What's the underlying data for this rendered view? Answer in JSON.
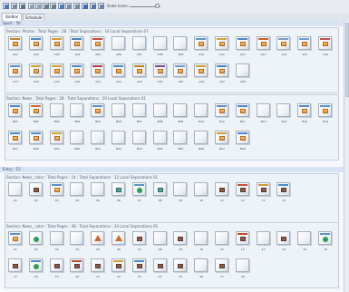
{
  "toolbar": {
    "scale_label": "Scale Icons:",
    "slider_value": 0.9,
    "icons": [
      "grid-view-icon",
      "list-view-icon",
      "page-view-icon",
      "zoom-out-icon",
      "zoom-in-icon",
      "undo-icon",
      "redo-icon",
      "refresh-icon",
      "print-icon",
      "settings-icon",
      "bar-chart-icon",
      "table-icon",
      "layers-icon"
    ]
  },
  "tabs": [
    {
      "label": "BinBox",
      "active": true
    },
    {
      "label": "Schedule",
      "active": false
    }
  ],
  "groups": [
    {
      "header": "Sport : 56",
      "sections": [
        {
          "title": "Section: Photos : Total Pages : 28 : Total Separations : 16 Local Separations 07",
          "pages": [
            {
              "label": "A01",
              "color": "#c47f2e",
              "icon": "orange"
            },
            {
              "label": "A02",
              "color": "#4b88c9",
              "icon": "orange"
            },
            {
              "label": "A03",
              "color": "#d29b38",
              "icon": "orange"
            },
            {
              "label": "A04",
              "color": "#4682be",
              "icon": "orange"
            },
            {
              "label": "A05",
              "color": "#c44d2f",
              "icon": "orange"
            },
            {
              "label": "A06",
              "color": "",
              "icon": "none"
            },
            {
              "label": "A07",
              "color": "",
              "icon": "none"
            },
            {
              "label": "A08",
              "color": "",
              "icon": "none"
            },
            {
              "label": "A09",
              "color": "",
              "icon": "none"
            },
            {
              "label": "A10",
              "color": "#5b96c7",
              "icon": "orange"
            },
            {
              "label": "A11",
              "color": "#d2a33c",
              "icon": "orange"
            },
            {
              "label": "A12",
              "color": "#4b88c9",
              "icon": "orange"
            },
            {
              "label": "A13",
              "color": "#c5612b",
              "icon": "orange"
            },
            {
              "label": "A14",
              "color": "#7b9dc2",
              "icon": "orange"
            },
            {
              "label": "A15",
              "color": "#6aa0d1",
              "icon": "orange"
            },
            {
              "label": "A16",
              "color": "#c34f56",
              "icon": "orange"
            },
            {
              "label": "A17",
              "color": "#5d93c8",
              "icon": "orange"
            },
            {
              "label": "A18",
              "color": "#d2a33c",
              "icon": "orange"
            },
            {
              "label": "A19",
              "color": "#d0a030",
              "icon": "orange"
            },
            {
              "label": "A20",
              "color": "#4f8bc6",
              "icon": "orange"
            },
            {
              "label": "A21",
              "color": "#b23e45",
              "icon": "orange"
            },
            {
              "label": "A22",
              "color": "#4f8bc6",
              "icon": "orange"
            },
            {
              "label": "A23",
              "color": "#c47f2e",
              "icon": "orange"
            },
            {
              "label": "A24",
              "color": "#7a4ca0",
              "icon": "orange"
            },
            {
              "label": "A25",
              "color": "#6aa0d1",
              "icon": "orange"
            },
            {
              "label": "A26",
              "color": "#d0a030",
              "icon": "orange"
            },
            {
              "label": "A27",
              "color": "#4b88c9",
              "icon": "orange"
            },
            {
              "label": "A28",
              "color": "",
              "icon": "none"
            }
          ]
        },
        {
          "title": "Section: News : Total Pages : 28 : Total Separations : 20 Local Separations 01",
          "pages": [
            {
              "label": "B01",
              "color": "#4b88c9",
              "icon": "orange"
            },
            {
              "label": "B02",
              "color": "#d06a2a",
              "icon": "orange"
            },
            {
              "label": "B03",
              "color": "",
              "icon": "none"
            },
            {
              "label": "B04",
              "color": "",
              "icon": "none"
            },
            {
              "label": "B05",
              "color": "#5d93c8",
              "icon": "orange"
            },
            {
              "label": "B06",
              "color": "",
              "icon": "none"
            },
            {
              "label": "B07",
              "color": "",
              "icon": "none"
            },
            {
              "label": "B08",
              "color": "",
              "icon": "none"
            },
            {
              "label": "B09",
              "color": "",
              "icon": "none"
            },
            {
              "label": "B10",
              "color": "",
              "icon": "none"
            },
            {
              "label": "B11",
              "color": "#5d93c8",
              "icon": "orange"
            },
            {
              "label": "B12",
              "color": "#4b88c9",
              "icon": "orange"
            },
            {
              "label": "B13",
              "color": "",
              "icon": "none"
            },
            {
              "label": "B14",
              "color": "",
              "icon": "none"
            },
            {
              "label": "B15",
              "color": "#4f8bc6",
              "icon": "orange"
            },
            {
              "label": "B16",
              "color": "#5d93c8",
              "icon": "orange"
            },
            {
              "label": "B17",
              "color": "#4b88c9",
              "icon": "orange"
            },
            {
              "label": "B18",
              "color": "#4f8bc6",
              "icon": "orange"
            },
            {
              "label": "B19",
              "color": "#d0a030",
              "icon": "orange"
            },
            {
              "label": "B20",
              "color": "",
              "icon": "none"
            },
            {
              "label": "B21",
              "color": "",
              "icon": "none"
            },
            {
              "label": "B22",
              "color": "",
              "icon": "none"
            },
            {
              "label": "B23",
              "color": "",
              "icon": "none"
            },
            {
              "label": "B24",
              "color": "",
              "icon": "none"
            },
            {
              "label": "B25",
              "color": "",
              "icon": "none"
            },
            {
              "label": "B26",
              "color": "",
              "icon": "none"
            },
            {
              "label": "B27",
              "color": "#d0a030",
              "icon": "orange"
            },
            {
              "label": "B28",
              "color": "#4b88c9",
              "icon": "orange"
            }
          ]
        }
      ]
    },
    {
      "header": "Entry : 15",
      "sections": [
        {
          "title": "Section: News_ color : Total Pages : 14 : Total Separations : 12 Local Separations 01",
          "pages": [
            {
              "label": "01",
              "color": "",
              "icon": "none"
            },
            {
              "label": "02",
              "color": "",
              "icon": "brown"
            },
            {
              "label": "03",
              "color": "#5a8fc9",
              "icon": "orange"
            },
            {
              "label": "04",
              "color": "",
              "icon": "none"
            },
            {
              "label": "05",
              "color": "",
              "icon": "none"
            },
            {
              "label": "06",
              "color": "",
              "icon": "teal"
            },
            {
              "label": "07",
              "color": "#5d93c8",
              "icon": "green"
            },
            {
              "label": "08",
              "color": "",
              "icon": "teal"
            },
            {
              "label": "09",
              "color": "",
              "icon": "none"
            },
            {
              "label": "10",
              "color": "",
              "icon": "none"
            },
            {
              "label": "11",
              "color": "",
              "icon": "brown"
            },
            {
              "label": "12",
              "color": "#c44d2f",
              "icon": "brown"
            },
            {
              "label": "13",
              "color": "#d29b38",
              "icon": "brown"
            },
            {
              "label": "14",
              "color": "#4b88c9",
              "icon": "brown"
            }
          ]
        },
        {
          "title": "Section: News_ color : Total Pages : 28 : Total Separations : 24 Local Separations 02",
          "pages": [
            {
              "label": "01",
              "color": "#5d93c8",
              "icon": "orange"
            },
            {
              "label": "02",
              "color": "",
              "icon": "green"
            },
            {
              "label": "03",
              "color": "",
              "icon": "none"
            },
            {
              "label": "04",
              "color": "",
              "icon": "none"
            },
            {
              "label": "05",
              "color": "",
              "icon": "triangle"
            },
            {
              "label": "06",
              "color": "",
              "icon": "triangle"
            },
            {
              "label": "07",
              "color": "",
              "icon": "brown"
            },
            {
              "label": "08",
              "color": "",
              "icon": "none"
            },
            {
              "label": "09",
              "color": "",
              "icon": "brown"
            },
            {
              "label": "10",
              "color": "",
              "icon": "none"
            },
            {
              "label": "11",
              "color": "",
              "icon": "none"
            },
            {
              "label": "12",
              "color": "#c44d2f",
              "icon": "brown"
            },
            {
              "label": "13",
              "color": "",
              "icon": "none"
            },
            {
              "label": "14",
              "color": "",
              "icon": "brown"
            },
            {
              "label": "15",
              "color": "",
              "icon": "none"
            },
            {
              "label": "16",
              "color": "#5d93c8",
              "icon": "green"
            },
            {
              "label": "17",
              "color": "",
              "icon": "brown"
            },
            {
              "label": "18",
              "color": "#4b88c9",
              "icon": "green"
            },
            {
              "label": "19",
              "color": "",
              "icon": "brown"
            },
            {
              "label": "20",
              "color": "#c44d2f",
              "icon": "brown"
            },
            {
              "label": "21",
              "color": "",
              "icon": "brown"
            },
            {
              "label": "22",
              "color": "#d29b38",
              "icon": "brown"
            },
            {
              "label": "23",
              "color": "#4b88c9",
              "icon": "brown"
            },
            {
              "label": "24",
              "color": "",
              "icon": "brown"
            },
            {
              "label": "25",
              "color": "",
              "icon": "brown"
            },
            {
              "label": "26",
              "color": "",
              "icon": "none"
            },
            {
              "label": "27",
              "color": "",
              "icon": "brown"
            },
            {
              "label": "28",
              "color": "",
              "icon": "none"
            }
          ]
        }
      ]
    }
  ]
}
